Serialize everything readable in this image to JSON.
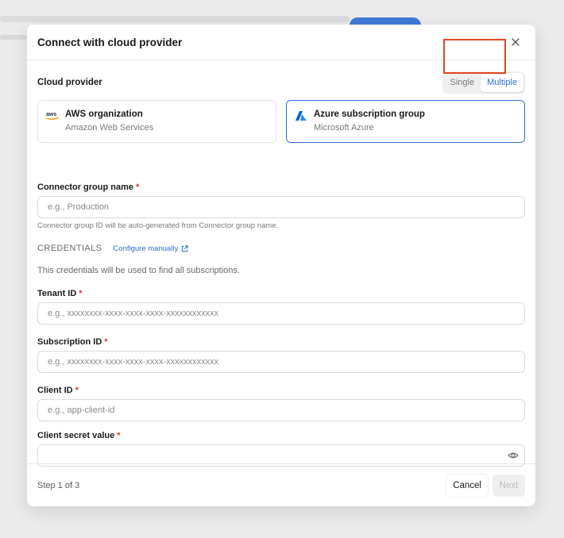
{
  "dialog": {
    "title": "Connect with cloud provider",
    "close_icon": "close-icon"
  },
  "cloud_provider": {
    "label": "Cloud provider",
    "toggle": {
      "options": [
        "Single",
        "Multiple"
      ],
      "selected": "Multiple"
    },
    "cards": [
      {
        "title": "AWS organization",
        "subtitle": "Amazon Web Services",
        "icon": "aws-logo-icon",
        "selected": false
      },
      {
        "title": "Azure subscription group",
        "subtitle": "Microsoft Azure",
        "icon": "azure-logo-icon",
        "selected": true
      }
    ]
  },
  "connector_group": {
    "label": "Connector group name",
    "required_mark": "*",
    "placeholder": "e.g., Production",
    "value": "",
    "hint": "Connector group ID will be auto-generated from Connector group name."
  },
  "credentials": {
    "title": "CREDENTIALS",
    "configure_link": "Configure manually",
    "description": "This credentials will be used to find all subscriptions.",
    "tenant_id": {
      "label": "Tenant ID",
      "required_mark": "*",
      "placeholder": "e.g., xxxxxxxx-xxxx-xxxx-xxxx-xxxxxxxxxxxx",
      "value": ""
    },
    "subscription_id": {
      "label": "Subscription ID",
      "required_mark": "*",
      "placeholder": "e.g., xxxxxxxx-xxxx-xxxx-xxxx-xxxxxxxxxxxx",
      "value": ""
    },
    "client_id": {
      "label": "Client ID",
      "required_mark": "*",
      "placeholder": "e.g., app-client-id",
      "value": ""
    },
    "client_secret": {
      "label": "Client secret value",
      "required_mark": "*",
      "placeholder": "",
      "value": "",
      "icon": "eye-icon"
    }
  },
  "footer": {
    "step": "Step 1 of 3",
    "cancel_label": "Cancel",
    "next_label": "Next"
  },
  "colors": {
    "accent": "#2f6fd6",
    "highlight_box": "#e0461e",
    "required": "#d43c3c"
  }
}
